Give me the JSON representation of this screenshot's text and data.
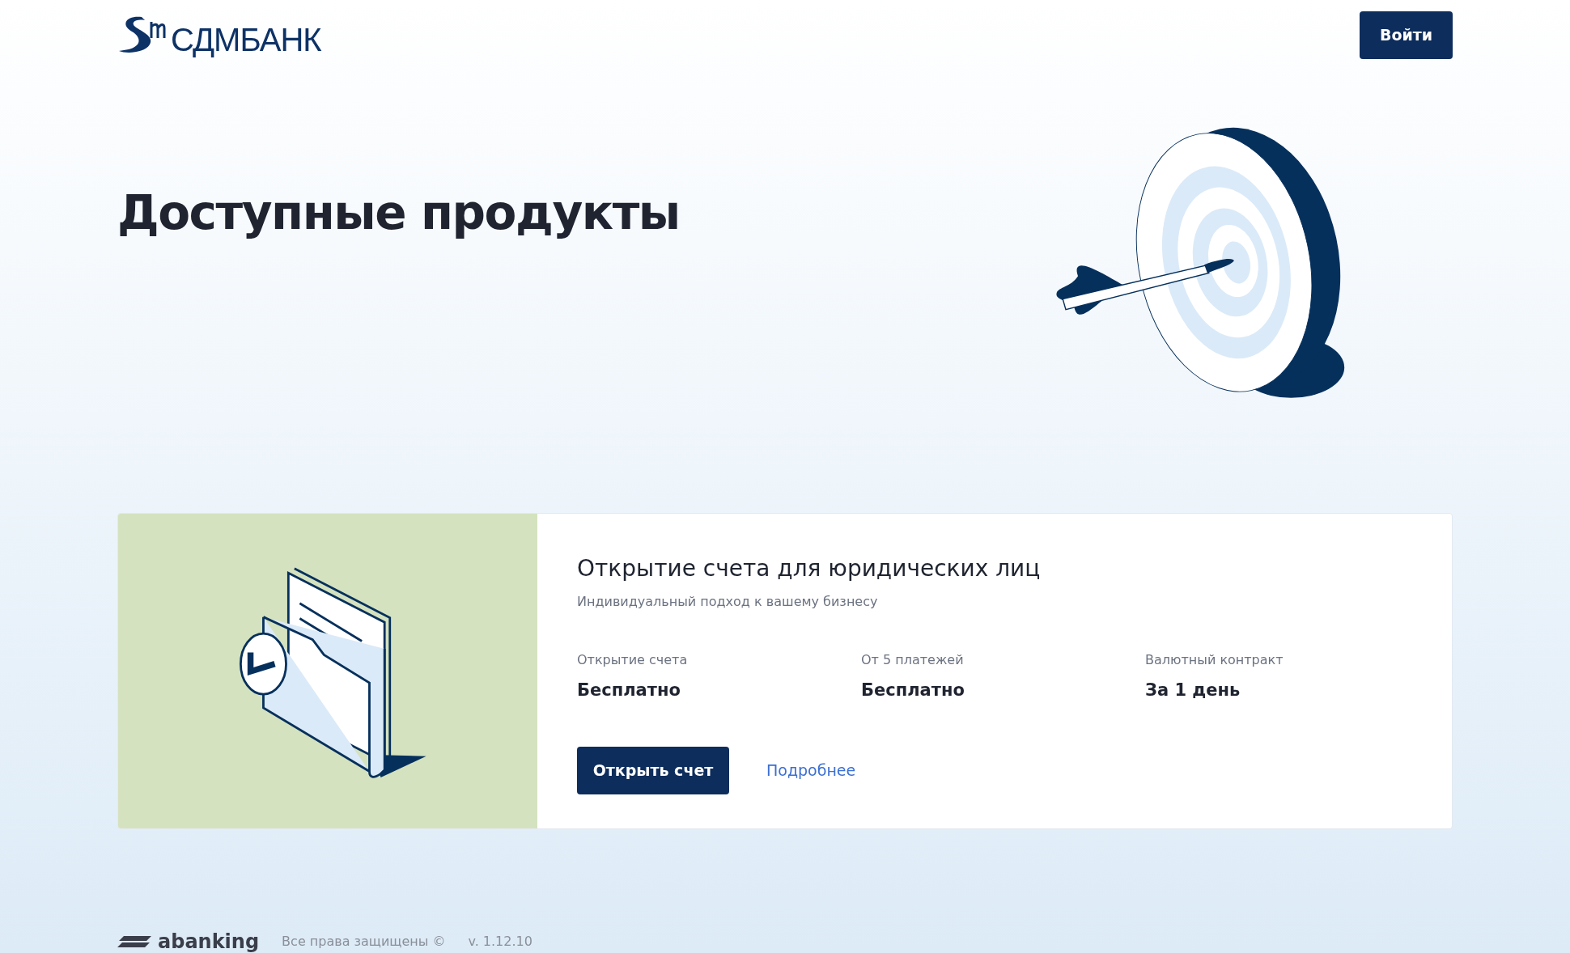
{
  "header": {
    "logo_text": "**СДМ**БАНК",
    "login_button": "Войти"
  },
  "page_title": "Доступные продукты",
  "products": [
    {
      "title": "Открытие счета для юридических лиц",
      "subtitle": "Индивидуальный подход к вашему бизнесу",
      "features": [
        {
          "label": "Открытие счета",
          "value": "Бесплатно"
        },
        {
          "label": "От 5 платежей",
          "value": "Бесплатно"
        },
        {
          "label": "Валютный контракт",
          "value": "За 1 день"
        }
      ],
      "primary_button": "Открыть счет",
      "link": "Подробнее"
    }
  ],
  "footer": {
    "brand": "abanking",
    "copyright": "Все права защищены ©",
    "version": "v. 1.12.10"
  }
}
